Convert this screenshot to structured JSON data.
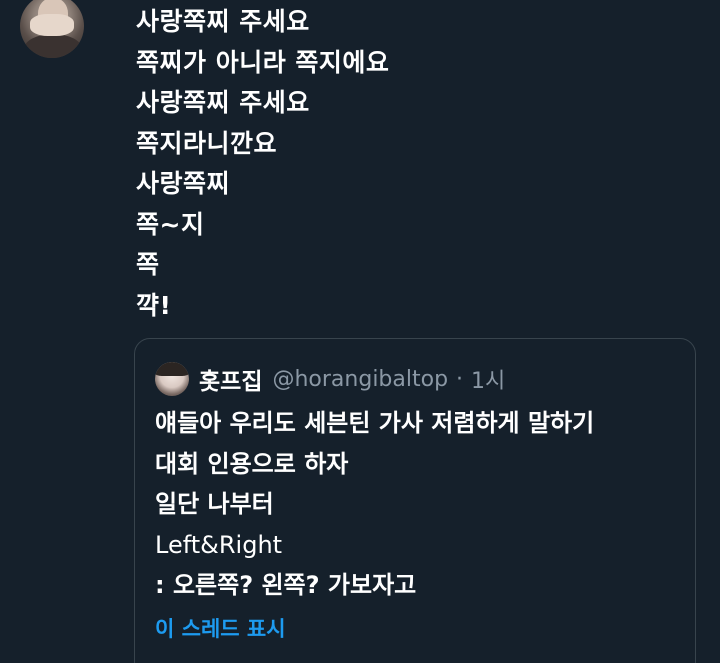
{
  "tweet": {
    "lines": [
      "사랑쪽찌 주세요",
      "쪽찌가 아니라 쪽지에요",
      "사랑쪽찌 주세요",
      "쪽지라니깐요",
      "사랑쪽찌",
      "쪽~지",
      "쪽",
      "꺅!"
    ]
  },
  "quote": {
    "display_name": "홋프집",
    "handle": "@horangibaltop",
    "separator": "·",
    "time": "1시",
    "body_lines": [
      "얘들아 우리도 세븐틴 가사 저렴하게 말하기",
      "대회 인용으로 하자",
      "일단 나부터",
      "Left&Right",
      ": 오른쪽? 왼쪽? 가보자고"
    ],
    "show_thread_label": "이 스레드 표시"
  },
  "colors": {
    "background": "#15202b",
    "text": "#ffffff",
    "secondary_text": "#8b98a5",
    "link": "#1d9bf0",
    "border": "#38444d"
  }
}
